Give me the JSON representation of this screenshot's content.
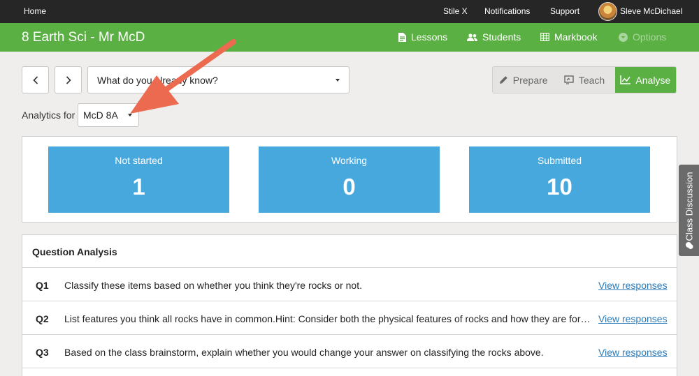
{
  "topbar": {
    "home": "Home",
    "links": [
      "Stile X",
      "Notifications",
      "Support"
    ],
    "user_name": "Sleve McDichael"
  },
  "header": {
    "course_title": "8 Earth Sci - Mr McD",
    "nav": [
      {
        "label": "Lessons",
        "icon": "document-icon"
      },
      {
        "label": "Students",
        "icon": "people-icon"
      },
      {
        "label": "Markbook",
        "icon": "grid-icon"
      },
      {
        "label": "Options",
        "icon": "chevron-circle-icon",
        "disabled": true
      }
    ]
  },
  "lesson_select": {
    "value": "What do you already know?"
  },
  "modes": [
    {
      "label": "Prepare",
      "icon": "pencil-icon"
    },
    {
      "label": "Teach",
      "icon": "presentation-icon"
    },
    {
      "label": "Analyse",
      "icon": "chart-icon",
      "active": true
    }
  ],
  "analytics": {
    "label": "Analytics for",
    "class_value": "McD 8A"
  },
  "stats": [
    {
      "label": "Not started",
      "value": "1"
    },
    {
      "label": "Working",
      "value": "0"
    },
    {
      "label": "Submitted",
      "value": "10"
    }
  ],
  "question_analysis": {
    "title": "Question Analysis",
    "view_label": "View responses",
    "questions": [
      {
        "num": "Q1",
        "text": "Classify these items based on whether you think they're rocks or not."
      },
      {
        "num": "Q2",
        "text": "List features you think all rocks have in common.Hint: Consider both the physical features of rocks and how they are formed."
      },
      {
        "num": "Q3",
        "text": "Based on the class brainstorm, explain whether you would change your answer on classifying the rocks above."
      }
    ]
  },
  "side_tab": {
    "label": "Class Discussion",
    "icon": "chat-icon"
  },
  "colors": {
    "green": "#5bb044",
    "blue": "#47a8de",
    "topbar": "#262626",
    "arrow": "#ec6a4f",
    "link": "#2b7bb9"
  }
}
